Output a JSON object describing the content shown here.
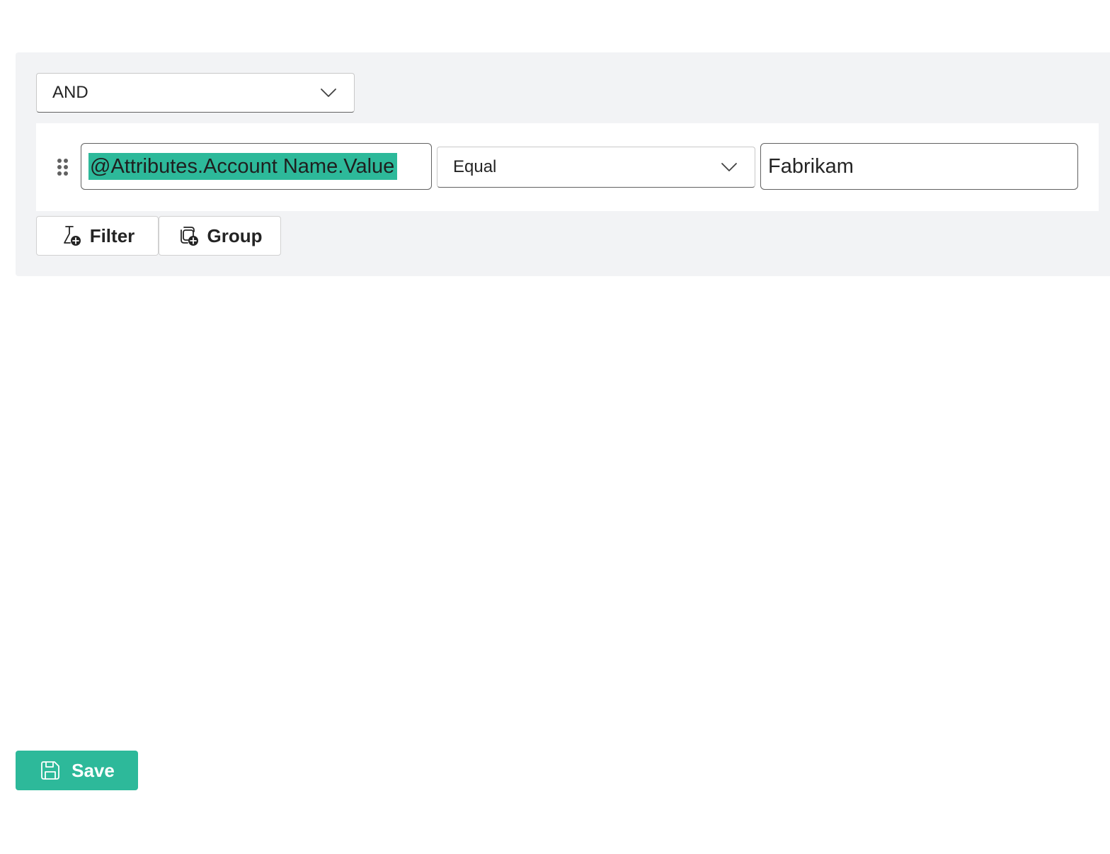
{
  "query_builder": {
    "logic_operator": {
      "selected": "AND",
      "icon": "chevron-down-icon"
    },
    "filter_row": {
      "drag_icon": "drag-handle-icon",
      "field": {
        "value": "@Attributes.Account Name.Value",
        "text_selected": true,
        "selection_color": "#2db99a"
      },
      "operator": {
        "selected": "Equal",
        "icon": "chevron-down-icon"
      },
      "value": {
        "value": "Fabrikam"
      }
    },
    "toolbar": {
      "filter_label": "Filter",
      "filter_icon": "filter-add-icon",
      "group_label": "Group",
      "group_icon": "group-add-icon"
    }
  },
  "footer": {
    "save_label": "Save",
    "save_icon": "save-icon",
    "accent_color": "#2db99a"
  }
}
